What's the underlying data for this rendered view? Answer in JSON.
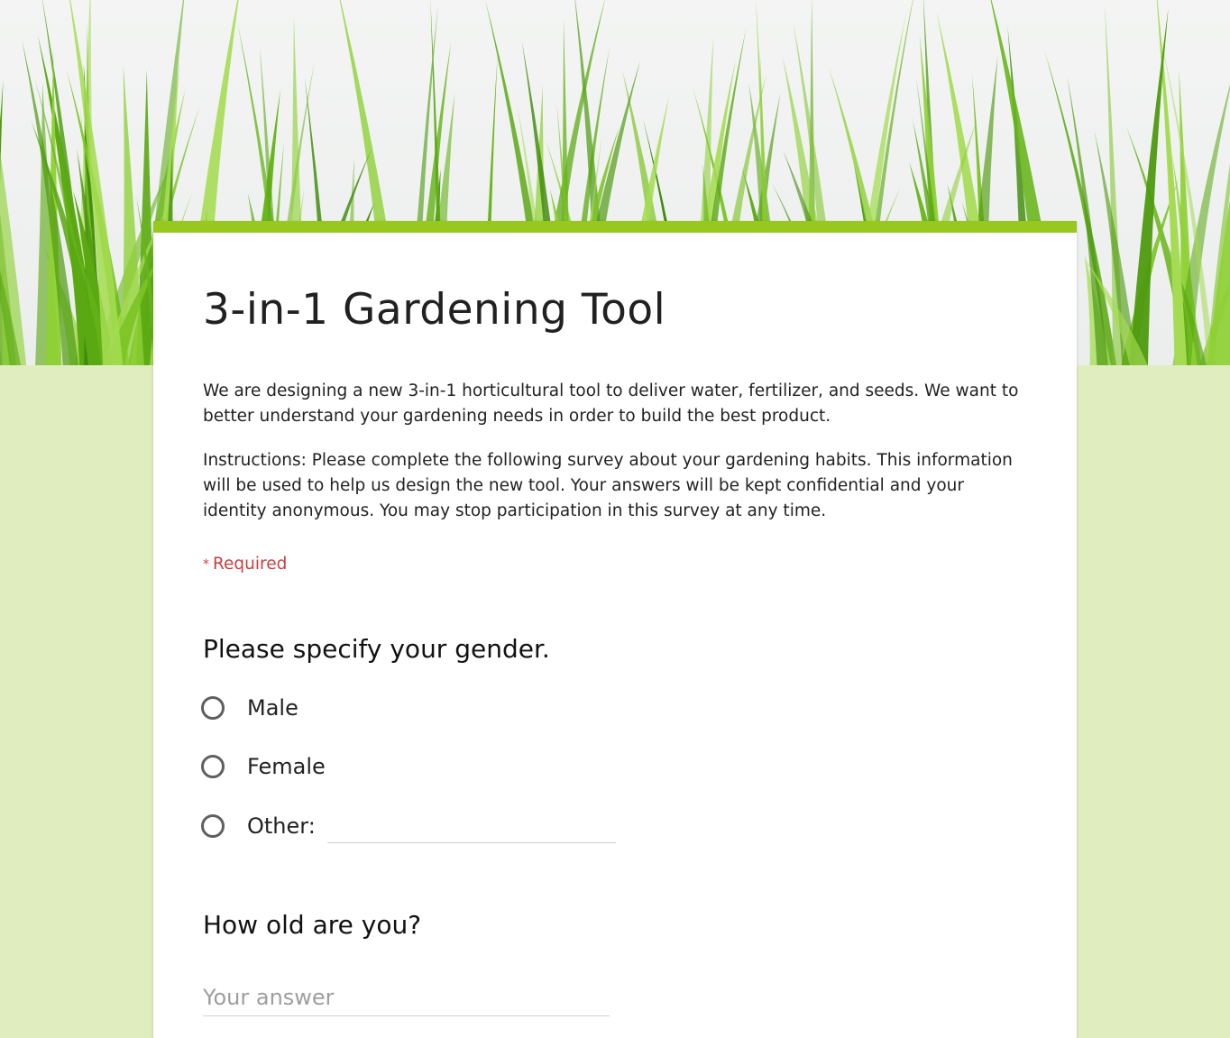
{
  "theme": {
    "accent": "#98c71d",
    "background": "#e0edbf",
    "required_color": "#c94040"
  },
  "form": {
    "title": "3-in-1 Gardening Tool",
    "description_1": "We are designing a new 3-in-1 horticultural tool to deliver water, fertilizer, and seeds. We want to better understand your gardening needs in order to build the best product.",
    "description_2": "Instructions: Please complete the following survey about your gardening habits. This information will be used to help us design the new tool. Your answers will be kept confidential and your identity anonymous. You may stop participation in this survey at any time.",
    "required_marker": "*",
    "required_label": "Required"
  },
  "questions": {
    "gender": {
      "title": "Please specify your gender.",
      "options": [
        "Male",
        "Female",
        "Other:"
      ],
      "other_value": ""
    },
    "age": {
      "title": "How old are you?",
      "placeholder": "Your answer",
      "value": ""
    }
  },
  "banner": {
    "icon": "grass-header-image"
  }
}
